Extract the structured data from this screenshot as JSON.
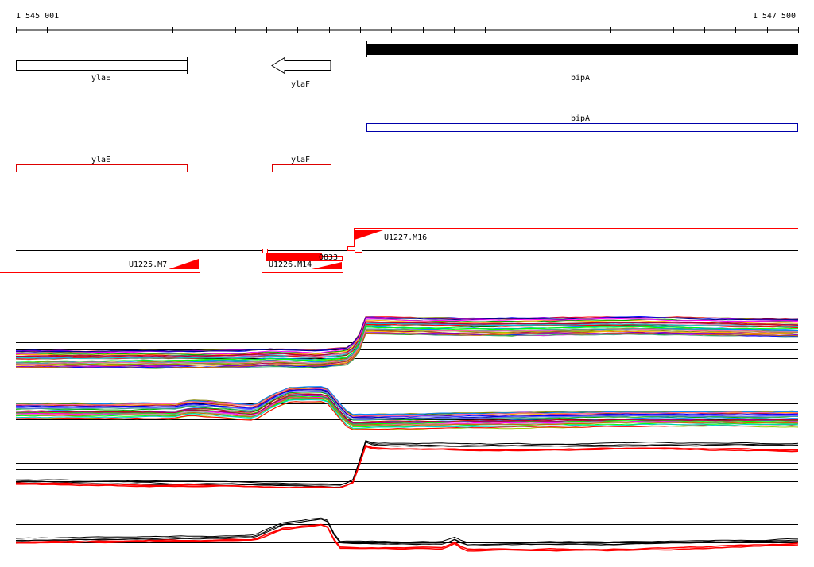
{
  "ruler": {
    "start_label": "1 545 001",
    "end_label": "1 547 500"
  },
  "annotation_track": {
    "genes": [
      {
        "name": "ylaE",
        "strand": "+"
      },
      {
        "name": "ylaF",
        "strand": "-"
      },
      {
        "name": "bipA",
        "strand": "+"
      }
    ]
  },
  "predicted_track": {
    "genes": [
      {
        "name": "bipA",
        "color": "#0000aa"
      },
      {
        "name": "ylaE",
        "color": "#dd0000"
      },
      {
        "name": "ylaF",
        "color": "#dd0000"
      }
    ]
  },
  "segments_track": {
    "segments": [
      {
        "name": "U1227.M16"
      },
      {
        "name": "U1225.M7"
      },
      {
        "name": "U1226.M14"
      },
      {
        "name": "0833"
      }
    ]
  },
  "colors": {
    "accent": "#ff0000",
    "blue": "#0000aa",
    "line": "#000000"
  }
}
